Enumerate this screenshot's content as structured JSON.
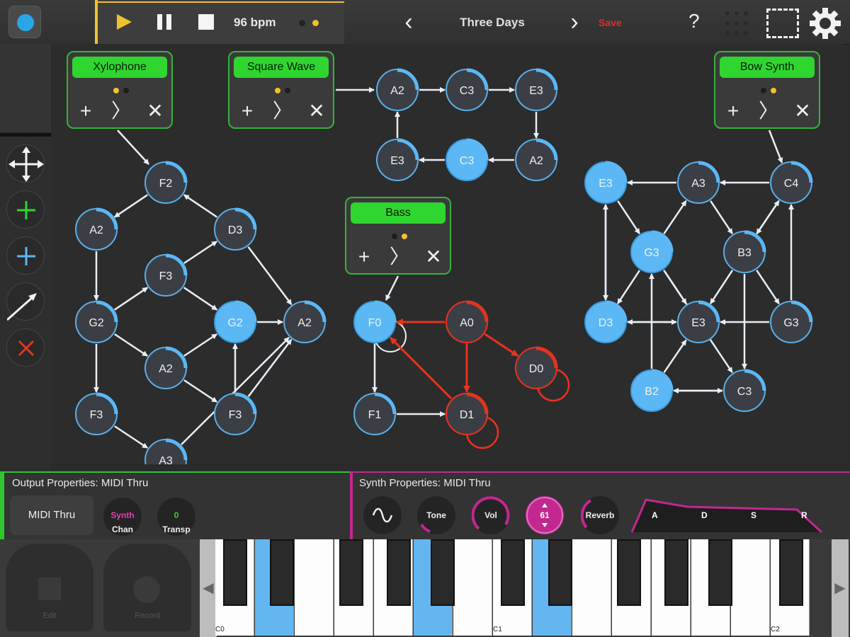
{
  "top_bar": {
    "bpm": "96 bpm",
    "song_title": "Three Days",
    "prev_label": "‹",
    "next_label": "›",
    "save_label": "Save",
    "help_label": "?",
    "colors": {
      "accent": "#f2c12e",
      "save": "#d9302c"
    }
  },
  "left_toolbar": {
    "tools": [
      "move-tool",
      "add-green-tool",
      "add-blue-tool",
      "connect-tool",
      "delete-tool"
    ]
  },
  "instruments": [
    {
      "name": "Xylophone"
    },
    {
      "name": "Square Wave"
    },
    {
      "name": "Bow Synth"
    },
    {
      "name": "Bass"
    }
  ],
  "instrument_controls": {
    "add": "+",
    "next": "〉",
    "remove": "✕"
  },
  "graph": {
    "xylophone_notes": [
      "F2",
      "A2",
      "D3",
      "F3",
      "G2",
      "G2",
      "A2",
      "A2",
      "F3",
      "F3",
      "A3"
    ],
    "square_notes": [
      "A2",
      "C3",
      "E3",
      "A2",
      "C3",
      "E3"
    ],
    "bass_notes": [
      "F0",
      "A0",
      "D0",
      "F1",
      "D1"
    ],
    "bow_notes": [
      "E3",
      "A3",
      "C4",
      "G3",
      "B3",
      "D3",
      "E3",
      "G3",
      "B2",
      "C3"
    ],
    "colors": {
      "node": "#3b3f45",
      "active": "#5bb8f5",
      "edge": "#e8eef5",
      "bass": "#e8321e"
    }
  },
  "output_properties": {
    "title": "Output Properties: MIDI Thru",
    "device": "MIDI Thru",
    "chan_value": "Synth",
    "chan_label": "Chan",
    "transp_value": "0",
    "transp_label": "Transp"
  },
  "synth_properties": {
    "title": "Synth Properties: MIDI Thru",
    "tone_label": "Tone",
    "vol_label": "Vol",
    "value": "61",
    "reverb_label": "Reverb",
    "adsr": [
      "A",
      "D",
      "S",
      "R"
    ]
  },
  "pads": {
    "edit": "Edit",
    "record": "Record"
  },
  "keyboard": {
    "labels": [
      "C0",
      "C1",
      "C2"
    ],
    "left_arrow": "◀",
    "right_arrow": "▶"
  }
}
